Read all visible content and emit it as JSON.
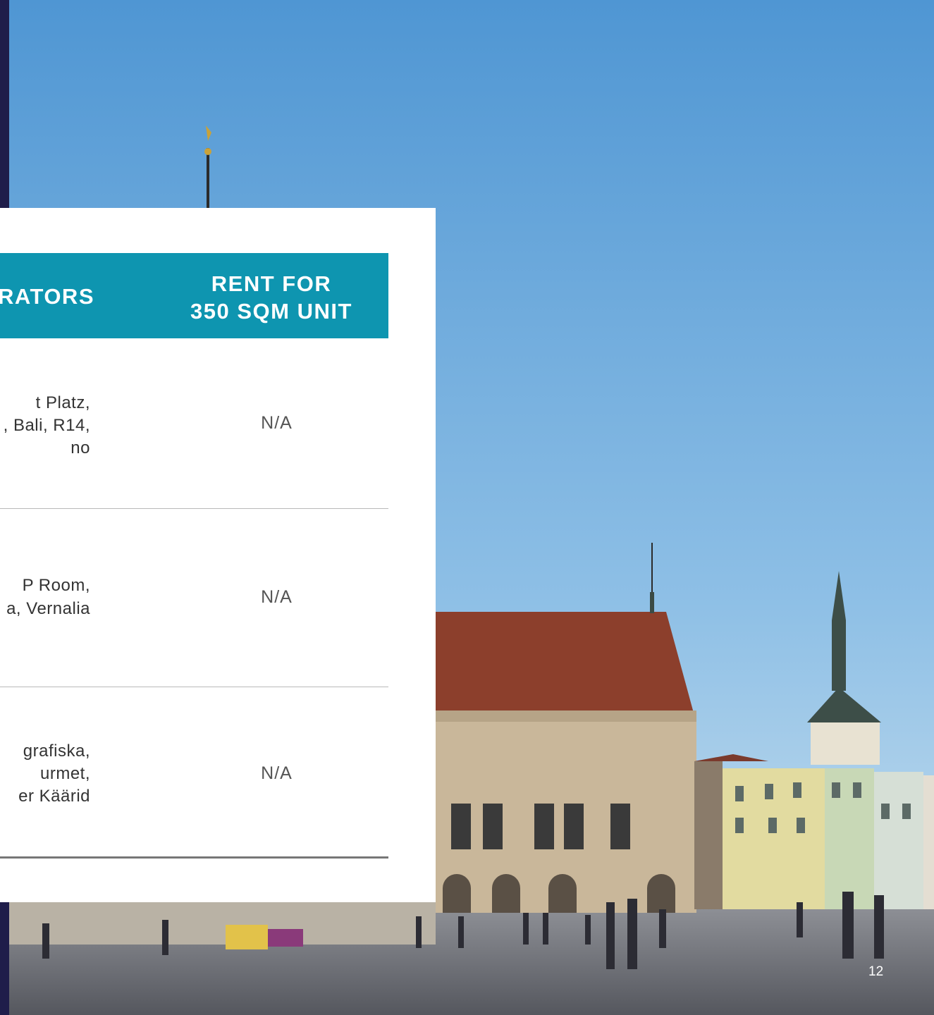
{
  "table": {
    "headers": {
      "operators": "RATORS",
      "rent_line1": "RENT FOR",
      "rent_line2": "350 SQM UNIT"
    },
    "rows": [
      {
        "operators": [
          "t Platz,",
          ", Bali, R14,",
          "no"
        ],
        "rent": "N/A"
      },
      {
        "operators": [
          "P Room,",
          "a, Vernalia"
        ],
        "rent": "N/A"
      },
      {
        "operators": [
          "grafiska,",
          "urmet,",
          "er Käärid"
        ],
        "rent": "N/A"
      }
    ]
  },
  "page_number": "12",
  "colors": {
    "header_bg": "#0e95b0",
    "sky": "#6aa8d8",
    "left_strip": "#1f1d4a"
  }
}
